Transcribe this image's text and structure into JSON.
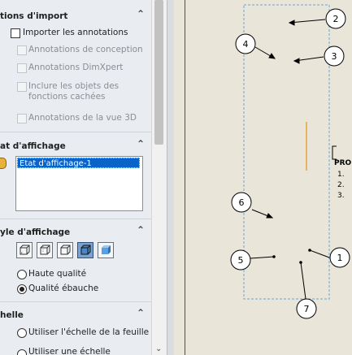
{
  "import_options": {
    "header": "tions d'import",
    "import_annotations": "Importer les annotations",
    "design_annotations": "Annotations de conception",
    "dimxpert_annotations": "Annotations DimXpert",
    "hidden_objects": [
      "Inclure les objets des",
      "fonctions cachées"
    ],
    "view_3d_annotations": "Annotations de la vue 3D"
  },
  "display_state": {
    "header": "at d'affichage",
    "selected": "Etat d'affichage-1"
  },
  "display_style": {
    "header": "yle d'affichage",
    "high_quality": "Haute qualité",
    "draft_quality": "Qualité ébauche",
    "selected_quality": "Qualité ébauche"
  },
  "scale": {
    "header": "helle",
    "use_sheet_scale": "Utiliser l'échelle de la feuille",
    "use_custom_scale": "Utiliser une échelle"
  },
  "drawing": {
    "balloons": [
      "1",
      "2",
      "3",
      "4",
      "5",
      "6",
      "7"
    ],
    "note_title": "PRO",
    "note_items": [
      "1.",
      "2.",
      "3."
    ]
  },
  "colors": {
    "panel_bg": "#e9edf2",
    "selection": "#0a63c9",
    "balloon_stroke": "#000000",
    "view_border": "#6aa3d6",
    "sketch_line": "#e8a33a"
  }
}
